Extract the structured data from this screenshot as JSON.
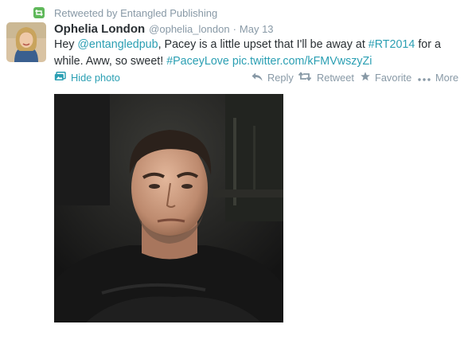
{
  "context": {
    "text": "Retweeted by Entangled Publishing",
    "icon": "retweet-icon",
    "color": "#5fb85a"
  },
  "tweet": {
    "fullname": "Ophelia London",
    "handle": "@ophelia_london",
    "separator": "·",
    "date": "May 13",
    "text": {
      "t1": "Hey ",
      "mention": "@entangledpub",
      "t2": ", Pacey is a little upset that I'll be away at ",
      "hashtag1": "#RT2014",
      "t3": " for a while. Aww, so sweet! ",
      "hashtag2": "#PaceyLove",
      "t4": " ",
      "link": "pic.twitter.com/kFMVwszyZi"
    }
  },
  "actions": {
    "hide_photo": "Hide photo",
    "reply": "Reply",
    "retweet": "Retweet",
    "favorite": "Favorite",
    "more": "More"
  },
  "colors": {
    "link": "#2b9fb3",
    "muted": "#8899a6",
    "text": "#292f33"
  }
}
